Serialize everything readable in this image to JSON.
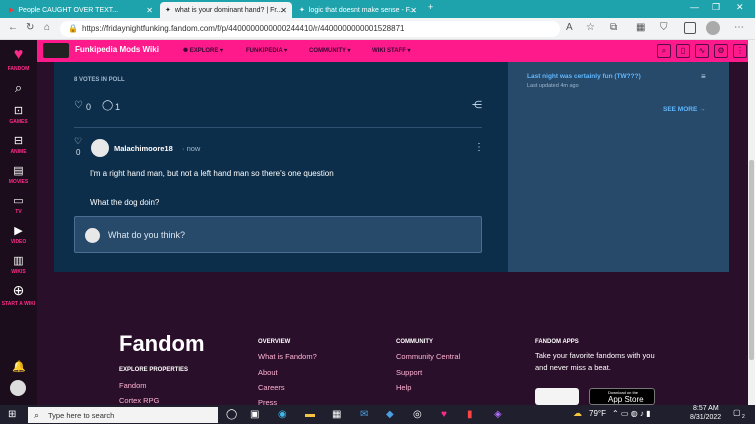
{
  "browser": {
    "tabs": [
      {
        "title": "People CAUGHT OVER TEXT...",
        "active": false
      },
      {
        "title": "what is your dominant hand? | Fr...",
        "active": true
      },
      {
        "title": "logic that doesnt make sense - F...",
        "active": false
      }
    ],
    "url": "https://fridaynightfunking.fandom.com/f/p/4400000000000244410/r/4400000000001528871"
  },
  "left_rail": {
    "items": [
      {
        "label": "FANDOM",
        "icon": "fandom-heart-icon"
      },
      {
        "label": "",
        "icon": "search-icon"
      },
      {
        "label": "GAMES",
        "icon": "gamepad-icon"
      },
      {
        "label": "ANIME",
        "icon": "anime-icon"
      },
      {
        "label": "MOVIES",
        "icon": "movie-icon"
      },
      {
        "label": "TV",
        "icon": "tv-icon"
      },
      {
        "label": "VIDEO",
        "icon": "video-icon"
      },
      {
        "label": "WIKIS",
        "icon": "wikis-icon"
      },
      {
        "label": "START A WIKI",
        "icon": "plus-icon"
      }
    ]
  },
  "wiki": {
    "name": "Funkipedia Mods Wiki",
    "nav": [
      "EXPLORE",
      "FUNKIPEDIA",
      "COMMUNITY",
      "WIKI STAFF"
    ]
  },
  "post": {
    "votes": "8 VOTES IN POLL",
    "likes": "0",
    "replies": "1"
  },
  "reply": {
    "score": "0",
    "author": "Malachimoore18",
    "time": "now",
    "lines": [
      "I'm a right hand man, but not a left hand man so there's one question",
      "What the dog doin?"
    ],
    "composer_placeholder": "What do you think?"
  },
  "sidebar": {
    "link": "Last night was certainly fun (TW???)",
    "updated": "Last updated 4m ago",
    "see_more": "SEE MORE"
  },
  "footer": {
    "logo": "Fandom",
    "explore_heading": "EXPLORE PROPERTIES",
    "explore_links": [
      "Fandom",
      "Cortex RPG"
    ],
    "overview_heading": "OVERVIEW",
    "overview_links": [
      "What is Fandom?",
      "About",
      "Careers",
      "Press"
    ],
    "community_heading": "COMMUNITY",
    "community_links": [
      "Community Central",
      "Support",
      "Help"
    ],
    "apps_heading": "FANDOM APPS",
    "apps_text": "Take your favorite fandoms with you and never miss a beat.",
    "app_store_small": "Download on the",
    "app_store_big": "App Store"
  },
  "taskbar": {
    "search_placeholder": "Type here to search",
    "weather": "79°F",
    "time": "8:57 AM",
    "date": "8/31/2022",
    "notifications": "2"
  },
  "colors": {
    "accent": "#ff1a8c",
    "panel": "#0d2e4a",
    "side": "#27496a",
    "link": "#60b8ff"
  }
}
